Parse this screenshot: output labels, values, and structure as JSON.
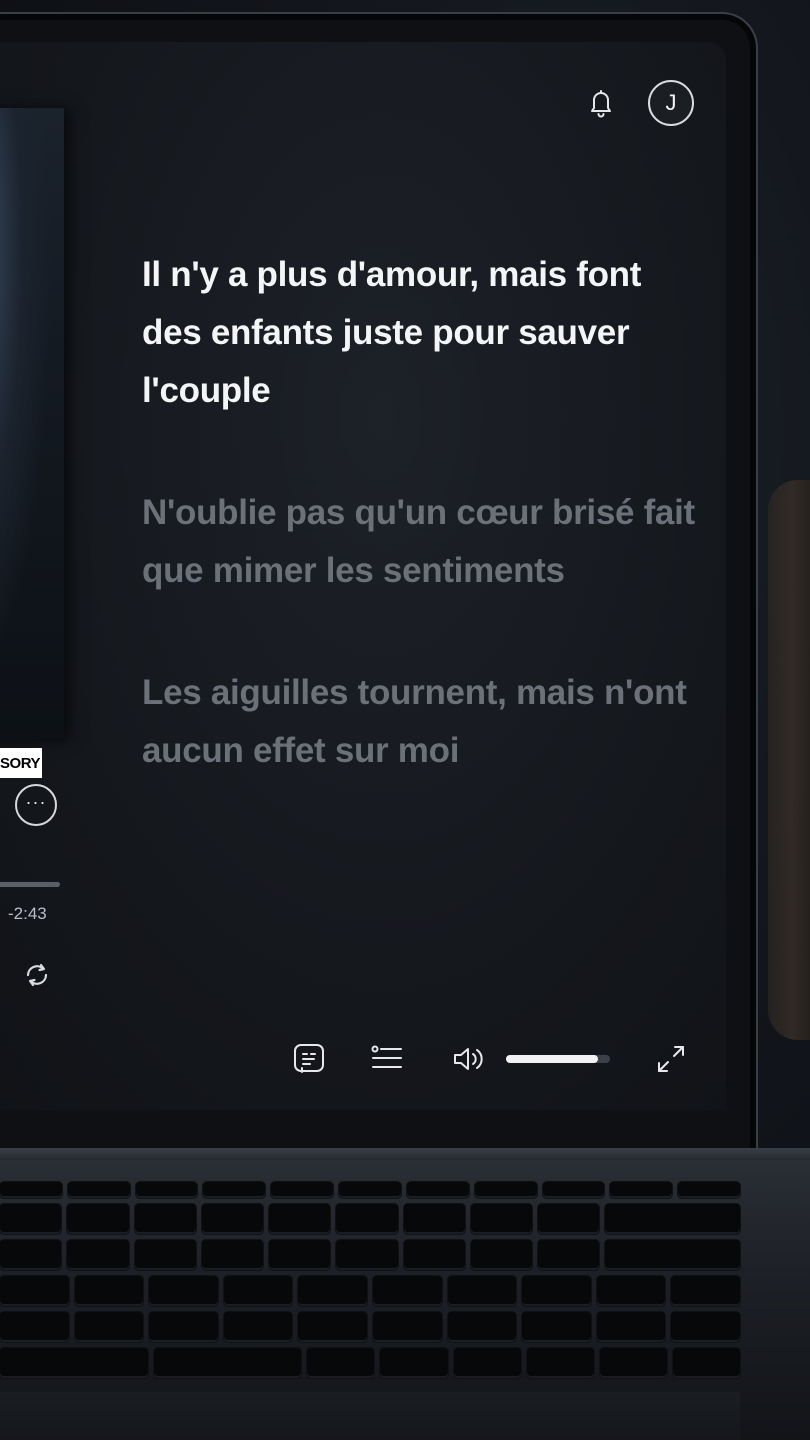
{
  "header": {
    "notifications_icon": "bell-icon",
    "avatar_initial": "J"
  },
  "album": {
    "advisory_text": "ISORY"
  },
  "player": {
    "more_label": "···",
    "time_remaining": "-2:43",
    "repeat_icon": "repeat-icon"
  },
  "lyrics": [
    {
      "text": "Il n'y a plus d'amour, mais font des enfants juste pour sauver l'couple",
      "active": true
    },
    {
      "text": "N'oublie pas qu'un cœur brisé fait que mimer les sentiments",
      "active": false
    },
    {
      "text": "Les aiguilles tournent, mais n'ont aucun effet sur moi",
      "active": false
    }
  ],
  "controls": {
    "lyrics_icon": "lyrics-icon",
    "queue_icon": "queue-icon",
    "volume_icon": "volume-icon",
    "volume_level": 0.88,
    "fullscreen_icon": "fullscreen-icon"
  },
  "colors": {
    "active_lyric": "#f4f5f7",
    "inactive_lyric": "#6c7078",
    "background": "#15181d"
  }
}
